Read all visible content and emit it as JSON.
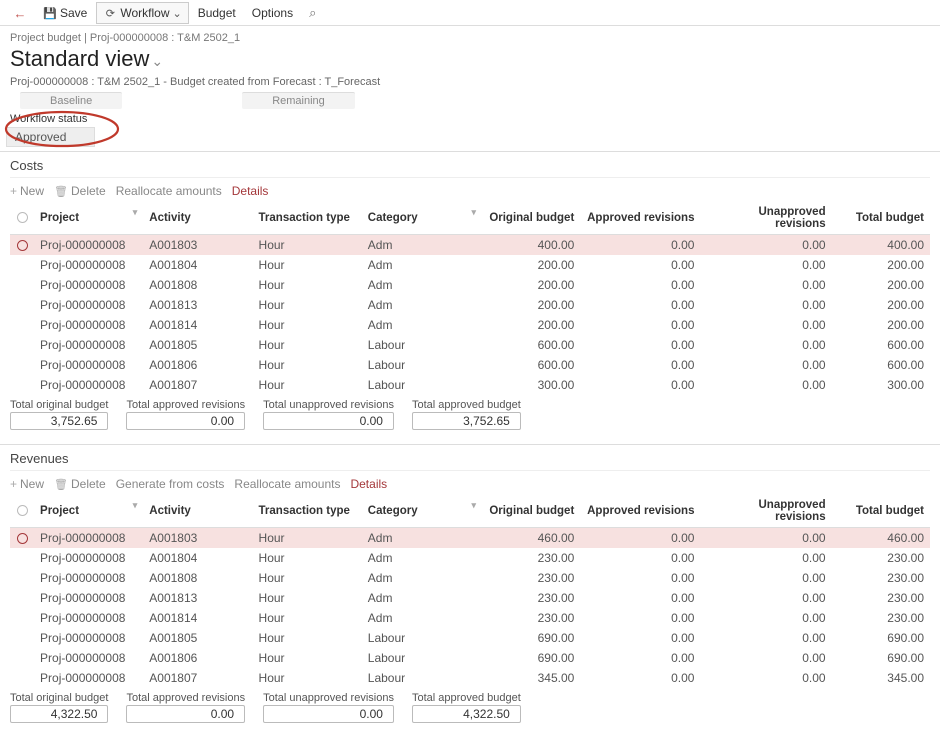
{
  "toolbar": {
    "save_label": "Save",
    "workflow_label": "Workflow",
    "budget_label": "Budget",
    "options_label": "Options"
  },
  "breadcrumb": "Project budget   |   Proj-000000008 : T&M 2502_1",
  "page_title": "Standard view",
  "subline": "Proj-000000008 : T&M 2502_1 - Budget created from Forecast : T_Forecast",
  "tabs": {
    "baseline": "Baseline",
    "remaining": "Remaining"
  },
  "workflow_status": {
    "label": "Workflow status",
    "value": "Approved"
  },
  "sections": {
    "costs": {
      "title": "Costs",
      "actions": {
        "new": "New",
        "delete": "Delete",
        "realloc": "Reallocate amounts",
        "details": "Details"
      }
    },
    "revenues": {
      "title": "Revenues",
      "actions": {
        "new": "New",
        "delete": "Delete",
        "genfromcosts": "Generate from costs",
        "realloc": "Reallocate amounts",
        "details": "Details"
      }
    }
  },
  "columns": {
    "project": "Project",
    "activity": "Activity",
    "txtype": "Transaction type",
    "category": "Category",
    "orig": "Original budget",
    "apprev": "Approved revisions",
    "unapprev": "Unapproved revisions",
    "total": "Total budget"
  },
  "costs_rows": [
    {
      "project": "Proj-000000008",
      "activity": "A001803",
      "txtype": "Hour",
      "category": "Adm",
      "orig": "400.00",
      "apprev": "0.00",
      "unapprev": "0.00",
      "total": "400.00",
      "sel": true
    },
    {
      "project": "Proj-000000008",
      "activity": "A001804",
      "txtype": "Hour",
      "category": "Adm",
      "orig": "200.00",
      "apprev": "0.00",
      "unapprev": "0.00",
      "total": "200.00"
    },
    {
      "project": "Proj-000000008",
      "activity": "A001808",
      "txtype": "Hour",
      "category": "Adm",
      "orig": "200.00",
      "apprev": "0.00",
      "unapprev": "0.00",
      "total": "200.00"
    },
    {
      "project": "Proj-000000008",
      "activity": "A001813",
      "txtype": "Hour",
      "category": "Adm",
      "orig": "200.00",
      "apprev": "0.00",
      "unapprev": "0.00",
      "total": "200.00"
    },
    {
      "project": "Proj-000000008",
      "activity": "A001814",
      "txtype": "Hour",
      "category": "Adm",
      "orig": "200.00",
      "apprev": "0.00",
      "unapprev": "0.00",
      "total": "200.00"
    },
    {
      "project": "Proj-000000008",
      "activity": "A001805",
      "txtype": "Hour",
      "category": "Labour",
      "orig": "600.00",
      "apprev": "0.00",
      "unapprev": "0.00",
      "total": "600.00"
    },
    {
      "project": "Proj-000000008",
      "activity": "A001806",
      "txtype": "Hour",
      "category": "Labour",
      "orig": "600.00",
      "apprev": "0.00",
      "unapprev": "0.00",
      "total": "600.00"
    },
    {
      "project": "Proj-000000008",
      "activity": "A001807",
      "txtype": "Hour",
      "category": "Labour",
      "orig": "300.00",
      "apprev": "0.00",
      "unapprev": "0.00",
      "total": "300.00"
    }
  ],
  "revenues_rows": [
    {
      "project": "Proj-000000008",
      "activity": "A001803",
      "txtype": "Hour",
      "category": "Adm",
      "orig": "460.00",
      "apprev": "0.00",
      "unapprev": "0.00",
      "total": "460.00",
      "sel": true
    },
    {
      "project": "Proj-000000008",
      "activity": "A001804",
      "txtype": "Hour",
      "category": "Adm",
      "orig": "230.00",
      "apprev": "0.00",
      "unapprev": "0.00",
      "total": "230.00"
    },
    {
      "project": "Proj-000000008",
      "activity": "A001808",
      "txtype": "Hour",
      "category": "Adm",
      "orig": "230.00",
      "apprev": "0.00",
      "unapprev": "0.00",
      "total": "230.00"
    },
    {
      "project": "Proj-000000008",
      "activity": "A001813",
      "txtype": "Hour",
      "category": "Adm",
      "orig": "230.00",
      "apprev": "0.00",
      "unapprev": "0.00",
      "total": "230.00"
    },
    {
      "project": "Proj-000000008",
      "activity": "A001814",
      "txtype": "Hour",
      "category": "Adm",
      "orig": "230.00",
      "apprev": "0.00",
      "unapprev": "0.00",
      "total": "230.00"
    },
    {
      "project": "Proj-000000008",
      "activity": "A001805",
      "txtype": "Hour",
      "category": "Labour",
      "orig": "690.00",
      "apprev": "0.00",
      "unapprev": "0.00",
      "total": "690.00"
    },
    {
      "project": "Proj-000000008",
      "activity": "A001806",
      "txtype": "Hour",
      "category": "Labour",
      "orig": "690.00",
      "apprev": "0.00",
      "unapprev": "0.00",
      "total": "690.00"
    },
    {
      "project": "Proj-000000008",
      "activity": "A001807",
      "txtype": "Hour",
      "category": "Labour",
      "orig": "345.00",
      "apprev": "0.00",
      "unapprev": "0.00",
      "total": "345.00"
    }
  ],
  "totals_labels": {
    "orig": "Total original budget",
    "apprev": "Total approved revisions",
    "unapprev": "Total unapproved revisions",
    "appbudget": "Total approved budget"
  },
  "costs_totals": {
    "orig": "3,752.65",
    "apprev": "0.00",
    "unapprev": "0.00",
    "appbudget": "3,752.65"
  },
  "revenues_totals": {
    "orig": "4,322.50",
    "apprev": "0.00",
    "unapprev": "0.00",
    "appbudget": "4,322.50"
  }
}
